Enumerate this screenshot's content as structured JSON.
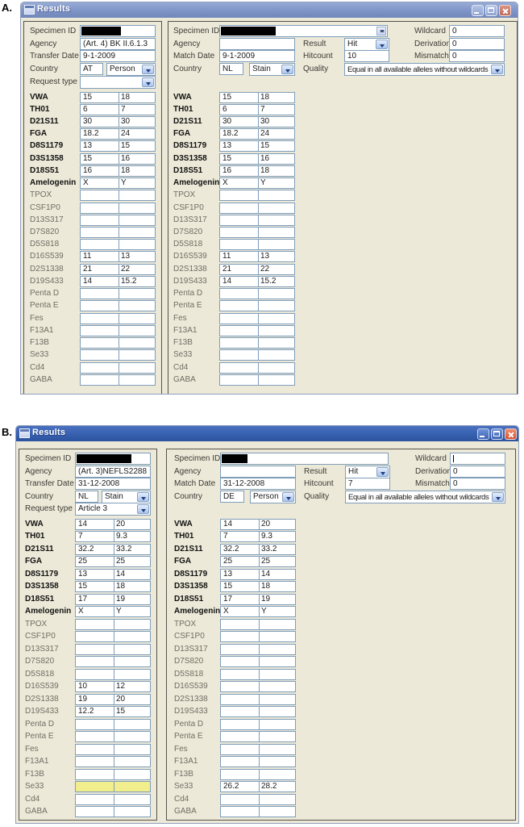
{
  "figure_labels": [
    "A.",
    "B."
  ],
  "windows": [
    {
      "label": "A.",
      "title": "Results",
      "left": {
        "specimen_label": "Specimen ID",
        "specimen_redacted_w": 49,
        "agency_label": "Agency",
        "agency": "(Art. 4) BK II.6.1.3",
        "date_label": "Transfer Date",
        "date": "9-1-2009",
        "country_label": "Country",
        "country_code": "AT",
        "country_type": "Person",
        "request_label": "Request type",
        "request_type": ""
      },
      "right": {
        "specimen_label": "Specimen ID",
        "specimen_redacted_w": 68,
        "spinner": true,
        "agency_label": "Agency",
        "agency": "",
        "date_label": "Match Date",
        "date": "9-1-2009",
        "country_label": "Country",
        "country_code": "NL",
        "country_type": "Stain",
        "result_label": "Result",
        "result": "Hit",
        "hitcount_label": "Hitcount",
        "hitcount": "10",
        "quality_label": "Quality",
        "quality": "Equal in all available alleles without wildcards",
        "wildcard_label": "Wildcard",
        "wildcard": "0",
        "wildcard_caret": false,
        "derivation_label": "Derivation",
        "derivation": "0",
        "mismatch_label": "Mismatch",
        "mismatch": "0"
      },
      "loci": [
        {
          "name": "VWA",
          "bold": true,
          "left": [
            "15",
            "18"
          ],
          "right": [
            "15",
            "18"
          ]
        },
        {
          "name": "TH01",
          "bold": true,
          "left": [
            "6",
            "7"
          ],
          "right": [
            "6",
            "7"
          ]
        },
        {
          "name": "D21S11",
          "bold": true,
          "left": [
            "30",
            "30"
          ],
          "right": [
            "30",
            "30"
          ]
        },
        {
          "name": "FGA",
          "bold": true,
          "left": [
            "18.2",
            "24"
          ],
          "right": [
            "18.2",
            "24"
          ]
        },
        {
          "name": "D8S1179",
          "bold": true,
          "left": [
            "13",
            "15"
          ],
          "right": [
            "13",
            "15"
          ]
        },
        {
          "name": "D3S1358",
          "bold": true,
          "left": [
            "15",
            "16"
          ],
          "right": [
            "15",
            "16"
          ]
        },
        {
          "name": "D18S51",
          "bold": true,
          "left": [
            "16",
            "18"
          ],
          "right": [
            "16",
            "18"
          ]
        },
        {
          "name": "Amelogenin",
          "bold": true,
          "left": [
            "X",
            "Y"
          ],
          "right": [
            "X",
            "Y"
          ]
        },
        {
          "name": "TPOX",
          "bold": false,
          "left": [
            "",
            ""
          ],
          "right": [
            "",
            ""
          ]
        },
        {
          "name": "CSF1P0",
          "bold": false,
          "left": [
            "",
            ""
          ],
          "right": [
            "",
            ""
          ]
        },
        {
          "name": "D13S317",
          "bold": false,
          "left": [
            "",
            ""
          ],
          "right": [
            "",
            ""
          ]
        },
        {
          "name": "D7S820",
          "bold": false,
          "left": [
            "",
            ""
          ],
          "right": [
            "",
            ""
          ]
        },
        {
          "name": "D5S818",
          "bold": false,
          "left": [
            "",
            ""
          ],
          "right": [
            "",
            ""
          ]
        },
        {
          "name": "D16S539",
          "bold": false,
          "left": [
            "11",
            "13"
          ],
          "right": [
            "11",
            "13"
          ]
        },
        {
          "name": "D2S1338",
          "bold": false,
          "left": [
            "21",
            "22"
          ],
          "right": [
            "21",
            "22"
          ]
        },
        {
          "name": "D19S433",
          "bold": false,
          "left": [
            "14",
            "15.2"
          ],
          "right": [
            "14",
            "15.2"
          ]
        },
        {
          "name": "Penta D",
          "bold": false,
          "left": [
            "",
            ""
          ],
          "right": [
            "",
            ""
          ]
        },
        {
          "name": "Penta E",
          "bold": false,
          "left": [
            "",
            ""
          ],
          "right": [
            "",
            ""
          ]
        },
        {
          "name": "Fes",
          "bold": false,
          "left": [
            "",
            ""
          ],
          "right": [
            "",
            ""
          ]
        },
        {
          "name": "F13A1",
          "bold": false,
          "left": [
            "",
            ""
          ],
          "right": [
            "",
            ""
          ]
        },
        {
          "name": "F13B",
          "bold": false,
          "left": [
            "",
            ""
          ],
          "right": [
            "",
            ""
          ]
        },
        {
          "name": "Se33",
          "bold": false,
          "left": [
            "",
            ""
          ],
          "right": [
            "",
            ""
          ]
        },
        {
          "name": "Cd4",
          "bold": false,
          "left": [
            "",
            ""
          ],
          "right": [
            "",
            ""
          ]
        },
        {
          "name": "GABA",
          "bold": false,
          "left": [
            "",
            ""
          ],
          "right": [
            "",
            ""
          ]
        }
      ]
    },
    {
      "label": "B.",
      "title": "Results",
      "left": {
        "specimen_label": "Specimen ID",
        "specimen_redacted_w": 68,
        "agency_label": "Agency",
        "agency": "(Art. 3)NEFLS2288",
        "date_label": "Transfer Date",
        "date": "31-12-2008",
        "country_label": "Country",
        "country_code": "NL",
        "country_type": "Stain",
        "request_label": "Request type",
        "request_type": "Article 3"
      },
      "right": {
        "specimen_label": "Specimen ID",
        "specimen_redacted_w": 32,
        "spinner": false,
        "agency_label": "Agency",
        "agency": "",
        "date_label": "Match Date",
        "date": "31-12-2008",
        "country_label": "Country",
        "country_code": "DE",
        "country_type": "Person",
        "result_label": "Result",
        "result": "Hit",
        "hitcount_label": "Hitcount",
        "hitcount": "7",
        "quality_label": "Quality",
        "quality": "Equal in all available alleles without wildcards",
        "wildcard_label": "Wildcard",
        "wildcard": "",
        "wildcard_caret": true,
        "derivation_label": "Derivation",
        "derivation": "0",
        "mismatch_label": "Mismatch",
        "mismatch": "0"
      },
      "loci": [
        {
          "name": "VWA",
          "bold": true,
          "left": [
            "14",
            "20"
          ],
          "right": [
            "14",
            "20"
          ]
        },
        {
          "name": "TH01",
          "bold": true,
          "left": [
            "7",
            "9.3"
          ],
          "right": [
            "7",
            "9.3"
          ]
        },
        {
          "name": "D21S11",
          "bold": true,
          "left": [
            "32.2",
            "33.2"
          ],
          "right": [
            "32.2",
            "33.2"
          ]
        },
        {
          "name": "FGA",
          "bold": true,
          "left": [
            "25",
            "25"
          ],
          "right": [
            "25",
            "25"
          ]
        },
        {
          "name": "D8S1179",
          "bold": true,
          "left": [
            "13",
            "14"
          ],
          "right": [
            "13",
            "14"
          ]
        },
        {
          "name": "D3S1358",
          "bold": true,
          "left": [
            "15",
            "18"
          ],
          "right": [
            "15",
            "18"
          ]
        },
        {
          "name": "D18S51",
          "bold": true,
          "left": [
            "17",
            "19"
          ],
          "right": [
            "17",
            "19"
          ]
        },
        {
          "name": "Amelogenin",
          "bold": true,
          "left": [
            "X",
            "Y"
          ],
          "right": [
            "X",
            "Y"
          ]
        },
        {
          "name": "TPOX",
          "bold": false,
          "left": [
            "",
            ""
          ],
          "right": [
            "",
            ""
          ]
        },
        {
          "name": "CSF1P0",
          "bold": false,
          "left": [
            "",
            ""
          ],
          "right": [
            "",
            ""
          ]
        },
        {
          "name": "D13S317",
          "bold": false,
          "left": [
            "",
            ""
          ],
          "right": [
            "",
            ""
          ]
        },
        {
          "name": "D7S820",
          "bold": false,
          "left": [
            "",
            ""
          ],
          "right": [
            "",
            ""
          ]
        },
        {
          "name": "D5S818",
          "bold": false,
          "left": [
            "",
            ""
          ],
          "right": [
            "",
            ""
          ]
        },
        {
          "name": "D16S539",
          "bold": false,
          "left": [
            "10",
            "12"
          ],
          "right": [
            "",
            ""
          ]
        },
        {
          "name": "D2S1338",
          "bold": false,
          "left": [
            "19",
            "20"
          ],
          "right": [
            "",
            ""
          ]
        },
        {
          "name": "D19S433",
          "bold": false,
          "left": [
            "12.2",
            "15"
          ],
          "right": [
            "",
            ""
          ]
        },
        {
          "name": "Penta D",
          "bold": false,
          "left": [
            "",
            ""
          ],
          "right": [
            "",
            ""
          ]
        },
        {
          "name": "Penta E",
          "bold": false,
          "left": [
            "",
            ""
          ],
          "right": [
            "",
            ""
          ]
        },
        {
          "name": "Fes",
          "bold": false,
          "left": [
            "",
            ""
          ],
          "right": [
            "",
            ""
          ]
        },
        {
          "name": "F13A1",
          "bold": false,
          "left": [
            "",
            ""
          ],
          "right": [
            "",
            ""
          ]
        },
        {
          "name": "F13B",
          "bold": false,
          "left": [
            "",
            ""
          ],
          "right": [
            "",
            ""
          ]
        },
        {
          "name": "Se33",
          "bold": false,
          "left": [
            "",
            ""
          ],
          "right": [
            "26.2",
            "28.2"
          ],
          "left_highlight": true
        },
        {
          "name": "Cd4",
          "bold": false,
          "left": [
            "",
            ""
          ],
          "right": [
            "",
            ""
          ]
        },
        {
          "name": "GABA",
          "bold": false,
          "left": [
            "",
            ""
          ],
          "right": [
            "",
            ""
          ]
        }
      ]
    }
  ]
}
